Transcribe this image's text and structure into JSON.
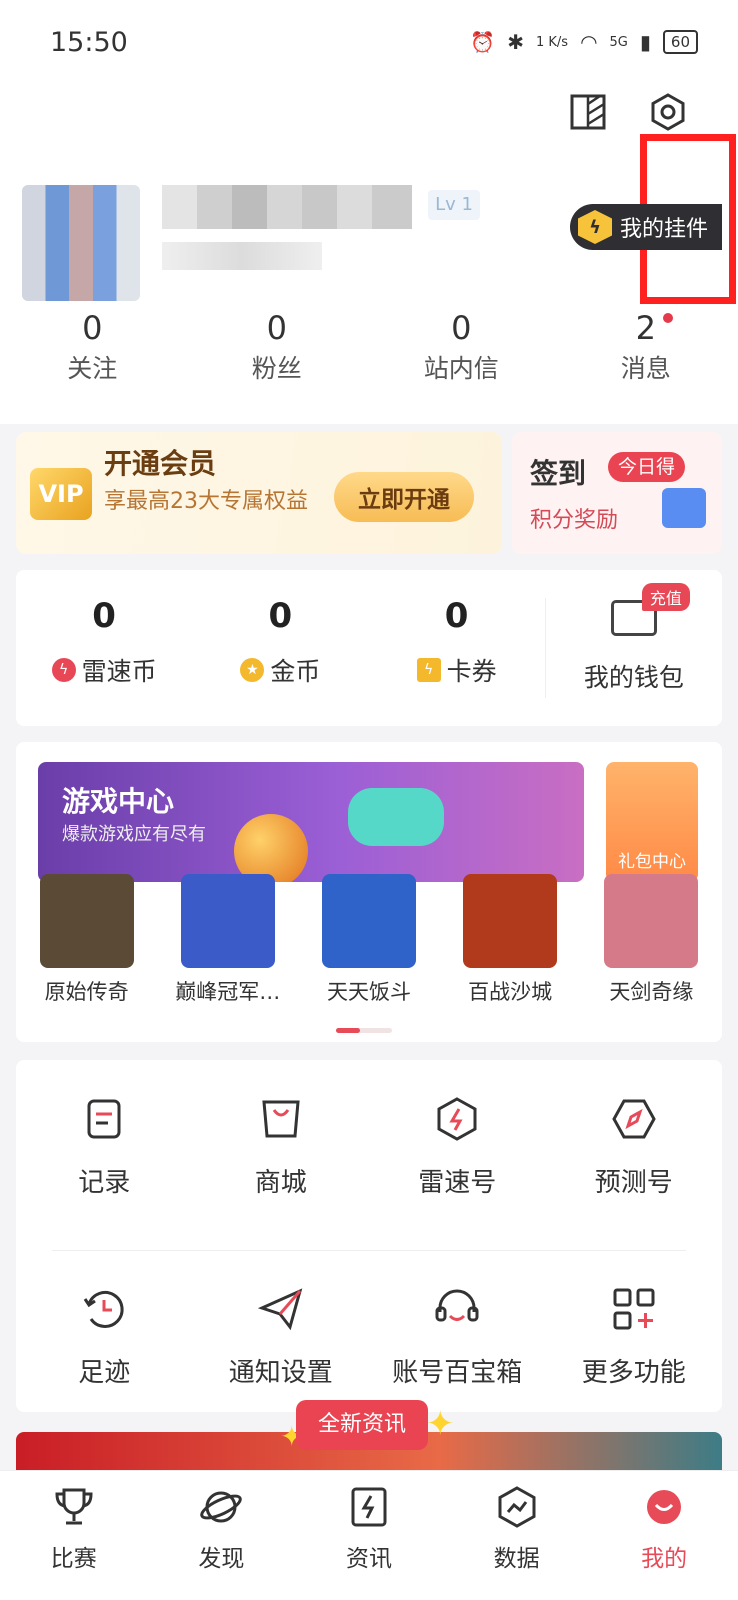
{
  "status_bar": {
    "time": "15:50",
    "net_speed": "1 K/s",
    "network": "5G",
    "battery": "60"
  },
  "profile": {
    "level": "Lv 1",
    "plugin_label": "我的挂件"
  },
  "stats": [
    {
      "value": "0",
      "label": "关注"
    },
    {
      "value": "0",
      "label": "粉丝"
    },
    {
      "value": "0",
      "label": "站内信"
    },
    {
      "value": "2",
      "label": "消息"
    }
  ],
  "vip": {
    "logo": "VIP",
    "title": "开通会员",
    "desc": "享最高23大专属权益",
    "button": "立即开通"
  },
  "sign": {
    "title": "签到",
    "badge": "今日得",
    "desc": "积分奖励"
  },
  "wallet": {
    "items": [
      {
        "value": "0",
        "label": "雷速币",
        "icon": "lightning-coin-icon"
      },
      {
        "value": "0",
        "label": "金币",
        "icon": "gold-coin-icon"
      },
      {
        "value": "0",
        "label": "卡券",
        "icon": "ticket-icon"
      }
    ],
    "my_wallet": "我的钱包",
    "recharge_badge": "充值"
  },
  "games": {
    "banner_title": "游戏中心",
    "banner_subtitle": "爆款游戏应有尽有",
    "gift_center": "礼包中心",
    "list": [
      {
        "name": "原始传奇",
        "color": "#5b4a35"
      },
      {
        "name": "巅峰冠军…",
        "color": "#3a5bc8"
      },
      {
        "name": "天天饭斗",
        "color": "#2f63c9"
      },
      {
        "name": "百战沙城",
        "color": "#b23a1c"
      },
      {
        "name": "天剑奇缘",
        "color": "#d57a88"
      }
    ]
  },
  "functions": {
    "row1": [
      {
        "label": "记录",
        "icon": "record-icon"
      },
      {
        "label": "商城",
        "icon": "shop-bag-icon"
      },
      {
        "label": "雷速号",
        "icon": "lightning-hex-icon"
      },
      {
        "label": "预测号",
        "icon": "compass-hex-icon"
      }
    ],
    "row2": [
      {
        "label": "足迹",
        "icon": "history-icon"
      },
      {
        "label": "通知设置",
        "icon": "paper-plane-icon"
      },
      {
        "label": "账号百宝箱",
        "icon": "headset-icon"
      },
      {
        "label": "更多功能",
        "icon": "grid-plus-icon"
      }
    ]
  },
  "news_pill": "全新资讯",
  "tabs": [
    {
      "label": "比赛",
      "icon": "trophy-icon",
      "active": false
    },
    {
      "label": "发现",
      "icon": "planet-icon",
      "active": false
    },
    {
      "label": "资讯",
      "icon": "news-icon",
      "active": false
    },
    {
      "label": "数据",
      "icon": "data-hex-icon",
      "active": false
    },
    {
      "label": "我的",
      "icon": "profile-face-icon",
      "active": true
    }
  ],
  "colors": {
    "accent": "#e74b58",
    "highlight_box": "#ff2020",
    "vip_gold": "#f7bc55"
  }
}
